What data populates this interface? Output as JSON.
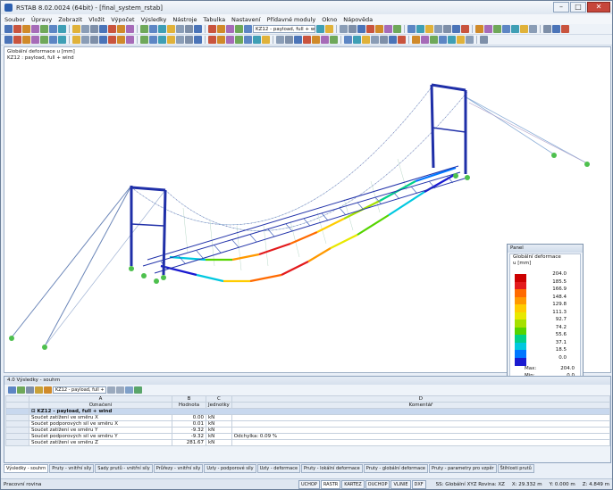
{
  "window": {
    "title": "RSTAB 8.02.0024 (64bit) - [final_system_rstab]"
  },
  "menu": [
    "Soubor",
    "Úpravy",
    "Zobrazit",
    "Vložit",
    "Výpočet",
    "Výsledky",
    "Nástroje",
    "Tabulka",
    "Nastavení",
    "Přídavné moduly",
    "Okno",
    "Nápověda"
  ],
  "toolbar": {
    "loadcase_combo": "KZ12 - payload, full + wind"
  },
  "viewport": {
    "info_line1": "Globální deformace u [mm]",
    "info_line2": "KZ12 : payload, full + wind"
  },
  "panel": {
    "title": "Panel",
    "heading1": "Globální deformace",
    "heading2": "u [mm]",
    "legend": [
      {
        "value": "204.0",
        "color": "#cc0000"
      },
      {
        "value": "185.5",
        "color": "#e31a1c"
      },
      {
        "value": "166.9",
        "color": "#ff6a00"
      },
      {
        "value": "148.4",
        "color": "#ff9900"
      },
      {
        "value": "129.8",
        "color": "#ffcc00"
      },
      {
        "value": "111.3",
        "color": "#e8e800"
      },
      {
        "value": "92.7",
        "color": "#a5e000"
      },
      {
        "value": "74.2",
        "color": "#55d400"
      },
      {
        "value": "55.6",
        "color": "#00d08a"
      },
      {
        "value": "37.1",
        "color": "#00c8e0"
      },
      {
        "value": "18.5",
        "color": "#0077ff"
      },
      {
        "value": "0.0",
        "color": "#1a1ad0"
      }
    ],
    "max_label": "Max:",
    "max_value": "204.0",
    "min_label": "Min:",
    "min_value": "0.0"
  },
  "results": {
    "title": "4.0 Výsledky - souhrn",
    "combo": "KZ12 - payload, full + ...",
    "col_letters": [
      "A",
      "B",
      "C",
      "D"
    ],
    "headers": [
      "Označení",
      "Hodnota",
      "Jednotky",
      "Komentář"
    ],
    "group_label": "KZ12 - payload, full + wind",
    "rows": [
      {
        "label": "Součet zatížení ve směru X",
        "value": "0.00",
        "unit": "kN",
        "comment": ""
      },
      {
        "label": "Součet podporových sil ve směru X",
        "value": "0.01",
        "unit": "kN",
        "comment": ""
      },
      {
        "label": "Součet zatížení ve směru Y",
        "value": "-9.32",
        "unit": "kN",
        "comment": ""
      },
      {
        "label": "Součet podporových sil ve směru Y",
        "value": "-9.32",
        "unit": "kN",
        "comment": "Odchylka:  0.09 %"
      },
      {
        "label": "Součet zatížení ve směru Z",
        "value": "281.67",
        "unit": "kN",
        "comment": ""
      }
    ]
  },
  "tabs": [
    "Výsledky - souhrn",
    "Pruty - vnitřní síly",
    "Sady prutů - vnitřní síly",
    "Průřezy - vnitřní síly",
    "Uzly - podporové síly",
    "Uzly - deformace",
    "Pruty - lokální deformace",
    "Pruty - globální deformace",
    "Pruty - parametry pro vzpěr",
    "Štíhlosti prutů"
  ],
  "status": {
    "left": "Pracovní rovina",
    "buttons": [
      "UCHOP",
      "RASTR",
      "KARTEZ",
      "OUCHOP",
      "VLINIE",
      "DXF"
    ],
    "plane": "SS: Globální XYZ  Rovina: XZ",
    "x": "X: 29.332 m",
    "y": "Y: 0.000 m",
    "z": "Z: 4.849 m"
  }
}
